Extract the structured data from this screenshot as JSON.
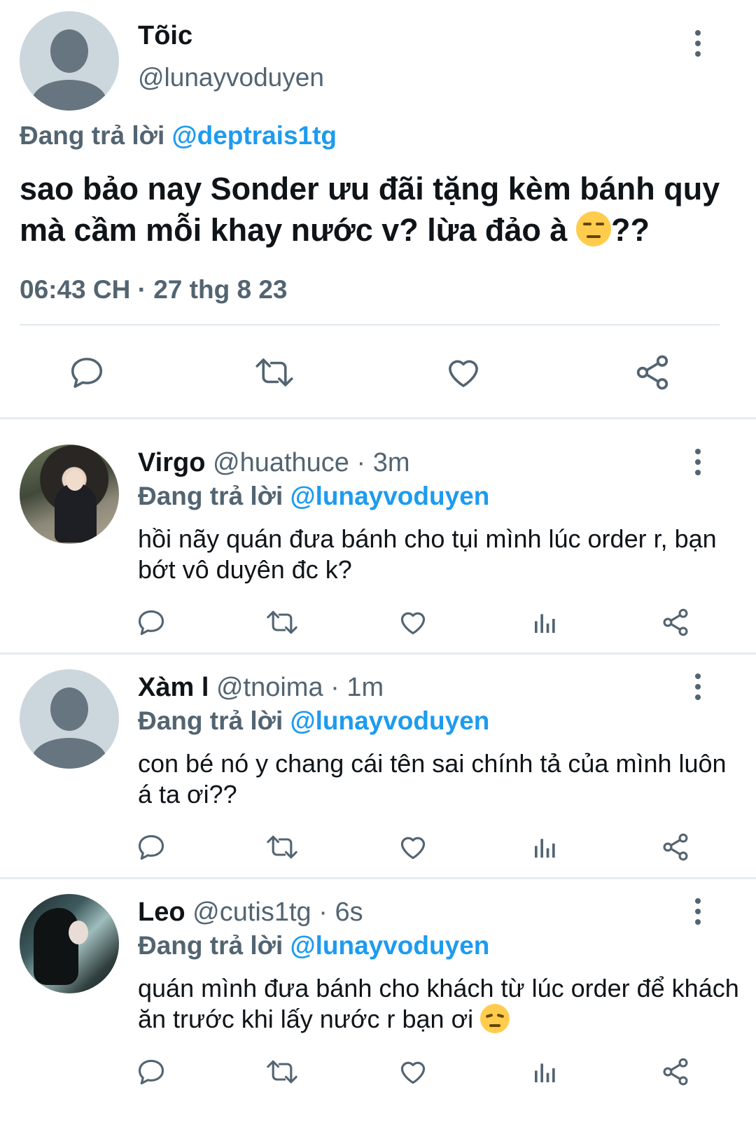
{
  "main_tweet": {
    "name": "Tõic",
    "handle": "@lunayvoduyen",
    "replying_prefix": "Đang trả lời",
    "replying_to": "@deptrais1tg",
    "text": "sao bảo nay Sonder ưu đãi tặng kèm bánh quy mà cầm mỗi khay nước v? lừa đảo à",
    "text_suffix": "??",
    "timestamp": "06:43 CH · 27 thg 8 23",
    "actions": [
      "reply-icon",
      "retweet-icon",
      "like-icon",
      "share-icon"
    ]
  },
  "replies": [
    {
      "name": "Virgo",
      "handle": "@huathuce",
      "time": "· 3m",
      "replying_prefix": "Đang trả lời",
      "replying_to": "@lunayvoduyen",
      "text": "hồi nãy quán đưa bánh cho tụi mình lúc order r, bạn bớt vô duyên đc k?",
      "avatar": "photo"
    },
    {
      "name": "Xàm l",
      "handle": "@tnoima",
      "time": "· 1m",
      "replying_prefix": "Đang trả lời",
      "replying_to": "@lunayvoduyen",
      "text": "con bé nó y chang cái tên sai chính tả của mình luôn á ta ơi??",
      "avatar": "default"
    },
    {
      "name": "Leo",
      "handle": "@cutis1tg",
      "time": "· 6s",
      "replying_prefix": "Đang trả lời",
      "replying_to": "@lunayvoduyen",
      "text": "quán mình đưa bánh cho khách từ lúc order để khách ăn trước khi lấy nước r bạn ơi",
      "avatar": "photo"
    }
  ],
  "colors": {
    "link": "#1d9bf0",
    "secondary_text": "#536471",
    "primary_text": "#0f1419",
    "icon": "#536471"
  }
}
